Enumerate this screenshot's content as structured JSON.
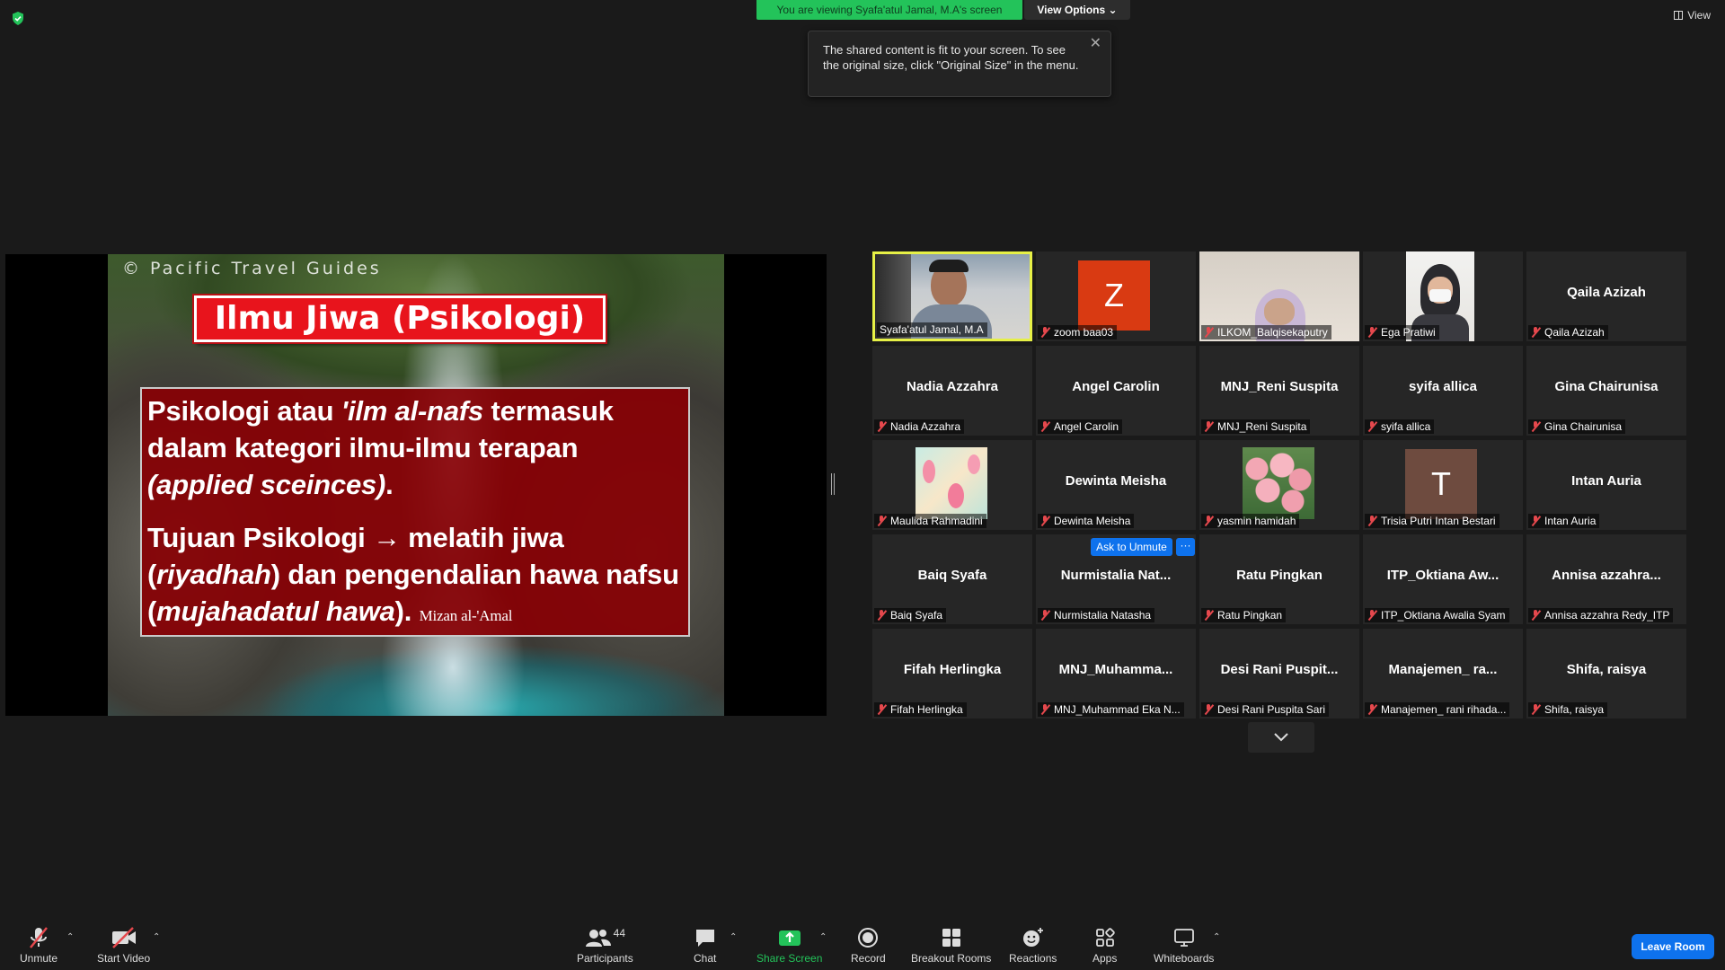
{
  "top": {
    "viewing_banner": "You are viewing Syafa'atul Jamal, M.A's screen",
    "view_options": "View Options",
    "view_label": "View",
    "tooltip_text": "The shared content is fit to your screen. To see the original size, click \"Original Size\" in the menu."
  },
  "slide": {
    "watermark": "© Pacific Travel Guides",
    "title": "Ilmu Jiwa (Psikologi)",
    "p1_a": "Psikologi atau ",
    "p1_b": "'ilm al-nafs",
    "p1_c": " termasuk dalam kategori ilmu-ilmu terapan ",
    "p1_d": "(applied sceinces)",
    "p1_e": ".",
    "p2_a": "Tujuan Psikologi ",
    "p2_arrow": "→",
    "p2_b": " melatih jiwa (",
    "p2_c": "riyadhah",
    "p2_d": ") dan pengendalian hawa nafsu (",
    "p2_e": "mujahadatul hawa",
    "p2_f": ").",
    "source": "Mizan al-'Amal"
  },
  "gallery": {
    "ask_to_unmute": "Ask to Unmute",
    "more": "···",
    "tiles": [
      {
        "label": "Syafa'atul Jamal, M.A",
        "center": "",
        "avatar": "",
        "kind": "video-man"
      },
      {
        "label": "zoom baa03",
        "center": "",
        "avatar": "Z",
        "kind": "letter"
      },
      {
        "label": "ILKOM_Balqisekaputry",
        "center": "",
        "avatar": "",
        "kind": "video-girl"
      },
      {
        "label": "Ega Pratiwi",
        "center": "",
        "avatar": "",
        "kind": "photo-hijab"
      },
      {
        "label": "Qaila Azizah",
        "center": "Qaila Azizah",
        "avatar": "",
        "kind": "name"
      },
      {
        "label": "Nadia Azzahra",
        "center": "Nadia Azzahra",
        "avatar": "",
        "kind": "name"
      },
      {
        "label": "Angel Carolin",
        "center": "Angel Carolin",
        "avatar": "",
        "kind": "name"
      },
      {
        "label": "MNJ_Reni Suspita",
        "center": "MNJ_Reni Suspita",
        "avatar": "",
        "kind": "name"
      },
      {
        "label": "syifa allica",
        "center": "syifa allica",
        "avatar": "",
        "kind": "name"
      },
      {
        "label": "Gina Chairunisa",
        "center": "Gina Chairunisa",
        "avatar": "",
        "kind": "name"
      },
      {
        "label": "Maulida Rahmadini",
        "center": "",
        "avatar": "",
        "kind": "photo-flamingo"
      },
      {
        "label": "Dewinta Meisha",
        "center": "Dewinta Meisha",
        "avatar": "",
        "kind": "name"
      },
      {
        "label": "yasmin hamidah",
        "center": "",
        "avatar": "",
        "kind": "photo-roses"
      },
      {
        "label": "Trisia Putri Intan Bestari",
        "center": "",
        "avatar": "T",
        "kind": "letter-brown"
      },
      {
        "label": "Intan Auria",
        "center": "Intan Auria",
        "avatar": "",
        "kind": "name"
      },
      {
        "label": "Baiq Syafa",
        "center": "Baiq Syafa",
        "avatar": "",
        "kind": "name"
      },
      {
        "label": "Nurmistalia Natasha",
        "center": "Nurmistalia  Nat...",
        "avatar": "",
        "kind": "name"
      },
      {
        "label": "Ratu Pingkan",
        "center": "Ratu Pingkan",
        "avatar": "",
        "kind": "name"
      },
      {
        "label": "ITP_Oktiana Awalia Syam",
        "center": "ITP_Oktiana  Aw...",
        "avatar": "",
        "kind": "name"
      },
      {
        "label": "Annisa azzahra Redy_ITP",
        "center": "Annisa  azzahra...",
        "avatar": "",
        "kind": "name"
      },
      {
        "label": "Fifah Herlingka",
        "center": "Fifah Herlingka",
        "avatar": "",
        "kind": "name"
      },
      {
        "label": "MNJ_Muhammad Eka N...",
        "center": "MNJ_Muhamma...",
        "avatar": "",
        "kind": "name"
      },
      {
        "label": "Desi Rani Puspita Sari",
        "center": "Desi  Rani  Puspit...",
        "avatar": "",
        "kind": "name"
      },
      {
        "label": "Manajemen_ rani rihada...",
        "center": "Manajemen_  ra...",
        "avatar": "",
        "kind": "name"
      },
      {
        "label": "Shifa, raisya",
        "center": "Shifa, raisya",
        "avatar": "",
        "kind": "name"
      }
    ]
  },
  "toolbar": {
    "unmute": "Unmute",
    "start_video": "Start Video",
    "participants": "Participants",
    "participants_count": "44",
    "chat": "Chat",
    "share_screen": "Share Screen",
    "record": "Record",
    "breakout_rooms": "Breakout Rooms",
    "reactions": "Reactions",
    "apps": "Apps",
    "whiteboards": "Whiteboards",
    "leave_room": "Leave Room"
  },
  "colors": {
    "banner_green": "#23c35a",
    "accent_blue": "#0e72ed",
    "mute_red": "#e5484d",
    "active_speaker": "#e6f046",
    "title_red": "#e8141c",
    "content_red": "#880004"
  }
}
